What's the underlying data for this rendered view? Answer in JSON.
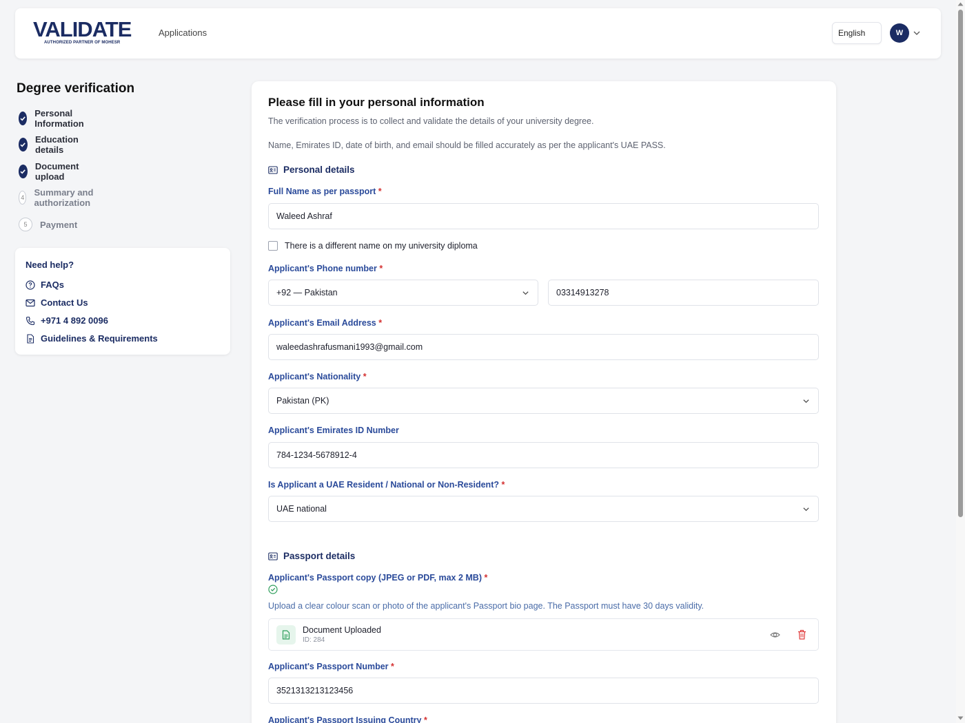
{
  "header": {
    "logo_text": "VALIDATE",
    "logo_tagline": "AUTHORIZED PARTNER OF MOHESR",
    "nav_applications": "Applications",
    "language": "English",
    "avatar_initial": "W"
  },
  "sidebar": {
    "title": "Degree verification",
    "steps": [
      {
        "label": "Personal Information",
        "status": "done"
      },
      {
        "label": "Education details",
        "status": "done"
      },
      {
        "label": "Document upload",
        "status": "done"
      },
      {
        "label": "Summary and authorization",
        "status": "todo",
        "number": "4"
      },
      {
        "label": "Payment",
        "status": "todo",
        "number": "5"
      }
    ],
    "help": {
      "title": "Need help?",
      "items": [
        {
          "label": "FAQs",
          "icon": "question-circle-icon"
        },
        {
          "label": "Contact Us",
          "icon": "mail-icon"
        },
        {
          "label": "+971 4 892 0096",
          "icon": "phone-icon"
        },
        {
          "label": "Guidelines & Requirements",
          "icon": "document-icon"
        }
      ]
    }
  },
  "form": {
    "title": "Please fill in your personal information",
    "desc1": "The verification process is to collect and validate the details of your university degree.",
    "desc2": "Name, Emirates ID, date of birth, and email should be filled accurately as per the applicant's UAE PASS.",
    "personal_section": "Personal details",
    "full_name_label": "Full Name as per passport",
    "full_name_value": "Waleed Ashraf",
    "diff_name_checkbox": "There is a different name on my university diploma",
    "phone_label": "Applicant's Phone number",
    "phone_country": "+92 — Pakistan",
    "phone_value": "03314913278",
    "email_label": "Applicant's Email Address",
    "email_value": "waleedashrafusmani1993@gmail.com",
    "nationality_label": "Applicant's Nationality",
    "nationality_value": "Pakistan (PK)",
    "emirates_id_label": "Applicant's Emirates ID Number",
    "emirates_id_value": "784-1234-5678912-4",
    "resident_label": "Is Applicant a UAE Resident / National or Non-Resident?",
    "resident_value": "UAE national",
    "passport_section": "Passport details",
    "passport_copy_label": "Applicant's Passport copy (JPEG or PDF, max 2 MB)",
    "passport_copy_hint": "Upload a clear colour scan or photo of the applicant's Passport bio page. The Passport must have 30 days validity.",
    "upload_title": "Document Uploaded",
    "upload_id": "ID: 284",
    "passport_number_label": "Applicant's Passport Number",
    "passport_number_value": "3521313213123456",
    "passport_country_label": "Applicant's Passport Issuing Country",
    "required_mark": "*"
  },
  "colors": {
    "brand": "#1b2c63",
    "label": "#2a4a9a",
    "required": "#d43030",
    "success": "#2e9e5b",
    "danger": "#e03a3a"
  }
}
